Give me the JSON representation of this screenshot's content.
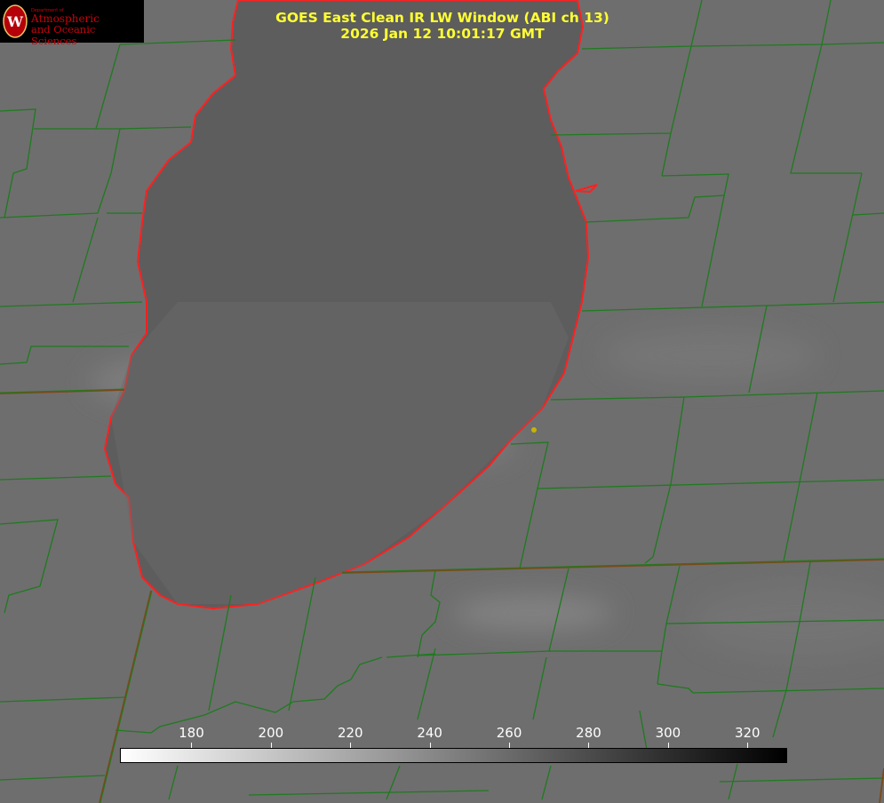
{
  "title": {
    "line1": "GOES East Clean IR LW Window (ABI ch 13)",
    "line2": "2026 Jan 12 10:01:17 GMT"
  },
  "logo": {
    "dept": "Department of",
    "line1": "Atmospheric",
    "line2": "and Oceanic Sciences",
    "seal_letter": "W"
  },
  "colorbar": {
    "ticks": [
      "180",
      "200",
      "220",
      "240",
      "260",
      "280",
      "300",
      "320"
    ],
    "tick_values": [
      180,
      200,
      220,
      240,
      260,
      280,
      300,
      320
    ],
    "min": 162,
    "max": 330
  },
  "colors": {
    "background": "#6f6f6f",
    "county_lines": "#1f7a1f",
    "state_lines": "#7a4a1a",
    "lake_outline": "#ff2020",
    "lake_fill": "#5f5f5f",
    "title": "#ffff33",
    "site_marker": "#c8b400"
  }
}
